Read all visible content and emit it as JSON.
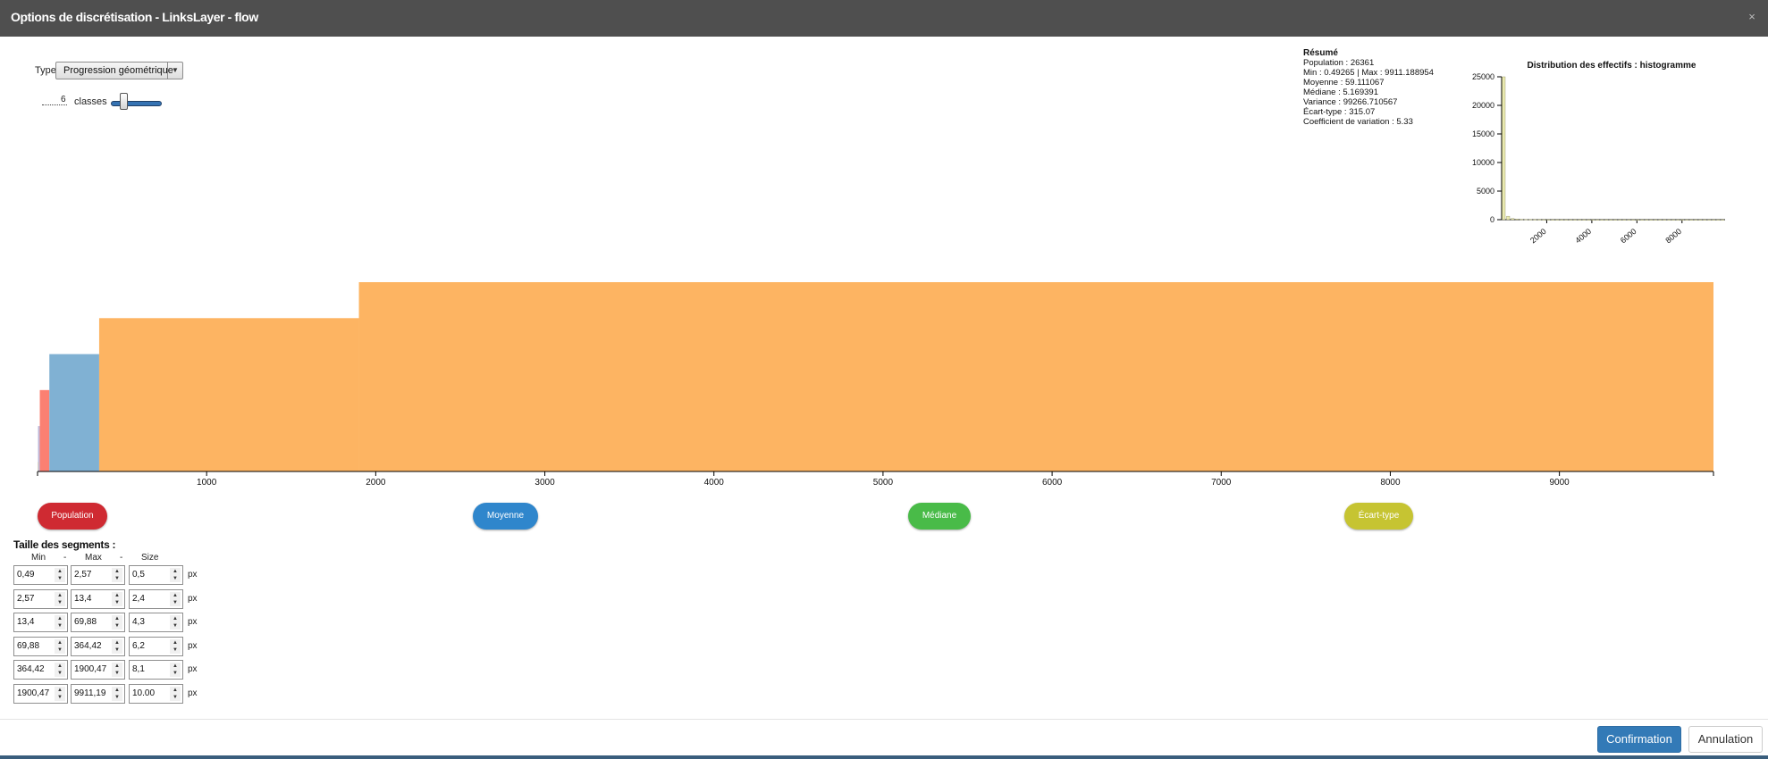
{
  "window": {
    "title": "Options de discrétisation - LinksLayer - flow",
    "close_glyph": "×"
  },
  "controls": {
    "type_label": "Type",
    "type_value": "Progression géométrique",
    "nb_class": "6",
    "classes_label": "classes",
    "slider_fraction": 0.3
  },
  "summary": {
    "title": "Résumé",
    "population": "Population : 26361",
    "minmax": "Min : 0.49265 | Max : 9911.188954",
    "mean": "Moyenne : 59.111067",
    "median": "Médiane : 5.169391",
    "variance": "Variance : 99266.710567",
    "stddev": "Écart-type : 315.07",
    "cv": "Coefficient de variation : 5.33"
  },
  "stat_buttons": {
    "population": "Population",
    "mean": "Moyenne",
    "median": "Médiane",
    "stddev": "Écart-type"
  },
  "segments": {
    "title": "Taille des segments :",
    "col_min": "Min",
    "col_sep1": "-",
    "col_max": "Max",
    "col_sep2": "-",
    "col_size": "Size",
    "unit": "px",
    "rows": [
      {
        "min": "0,49",
        "max": "2,57",
        "size": "0,5"
      },
      {
        "min": "2,57",
        "max": "13,4",
        "size": "2,4"
      },
      {
        "min": "13,4",
        "max": "69,88",
        "size": "4,3"
      },
      {
        "min": "69,88",
        "max": "364,42",
        "size": "6,2"
      },
      {
        "min": "364,42",
        "max": "1900,47",
        "size": "8,1"
      },
      {
        "min": "1900,47",
        "max": "9911,19",
        "size": "10.00"
      }
    ]
  },
  "footer": {
    "confirm": "Confirmation",
    "cancel": "Annulation"
  },
  "colors": {
    "population": "#cf2a32",
    "mean": "#2f86cc",
    "median": "#49bb48",
    "stddev": "#c6c432",
    "class_colors": [
      "#f4ee9c",
      "#beb9db",
      "#fb8072",
      "#80b1d3",
      "#fdb462",
      "#fdb462"
    ]
  },
  "chart_data": [
    {
      "type": "bar",
      "title": "",
      "xlim": [
        0,
        9911.19
      ],
      "xticks": [
        "1000",
        "2000",
        "3000",
        "4000",
        "5000",
        "6000",
        "7000",
        "8000",
        "9000"
      ],
      "bins": [
        {
          "min": 0.49,
          "max": 2.57,
          "size": 0.5
        },
        {
          "min": 2.57,
          "max": 13.4,
          "size": 2.4
        },
        {
          "min": 13.4,
          "max": 69.88,
          "size": 4.3
        },
        {
          "min": 69.88,
          "max": 364.42,
          "size": 6.2
        },
        {
          "min": 364.42,
          "max": 1900.47,
          "size": 8.1
        },
        {
          "min": 1900.47,
          "max": 9911.19,
          "size": 10.0
        }
      ],
      "ylim": [
        0,
        10
      ]
    },
    {
      "type": "bar",
      "title": "Distribution des effectifs : histogramme",
      "xlim": [
        0,
        9911.19
      ],
      "ylim": [
        0,
        25000
      ],
      "yticks": [
        "0",
        "5000",
        "10000",
        "15000",
        "20000",
        "25000"
      ],
      "xticks": [
        "2000",
        "4000",
        "6000",
        "8000"
      ],
      "values": [
        25000,
        600,
        200,
        120,
        70,
        50,
        30,
        20,
        15,
        10,
        8,
        6,
        5,
        5,
        4,
        4,
        3,
        3,
        3,
        2,
        2,
        2,
        2,
        2,
        2,
        1,
        1,
        1,
        1,
        1,
        1,
        1,
        1,
        1,
        1,
        1,
        1,
        1,
        1,
        1,
        1,
        1,
        1,
        1,
        1,
        1,
        1,
        1,
        1,
        1
      ]
    }
  ]
}
